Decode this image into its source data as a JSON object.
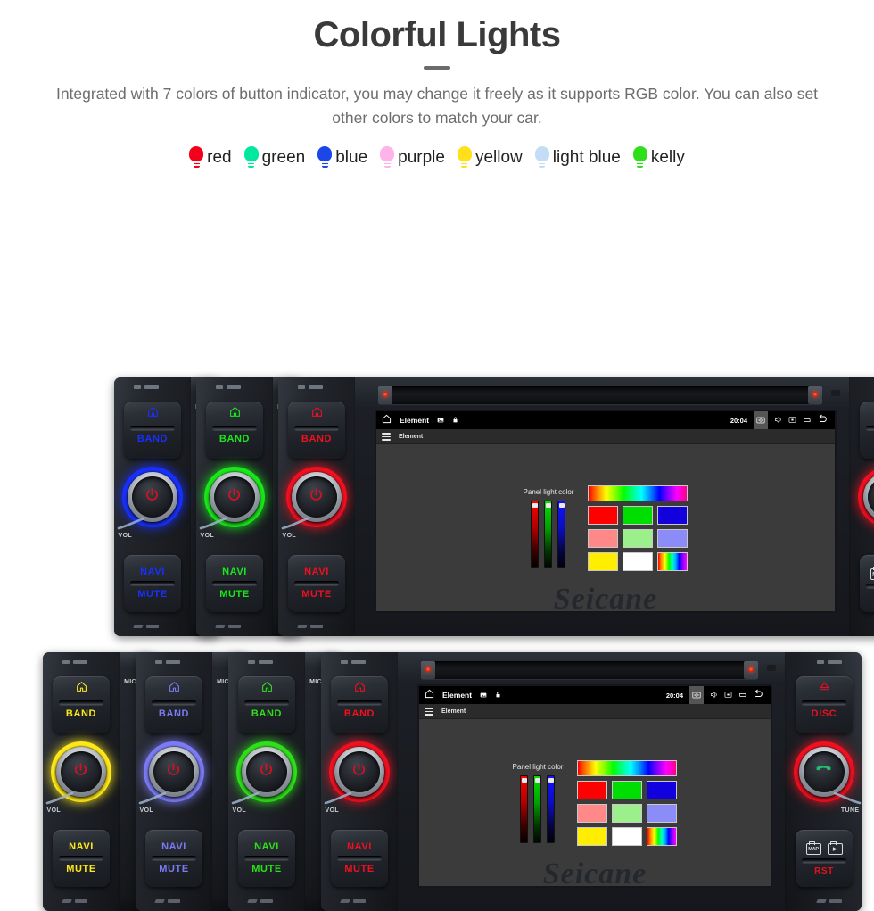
{
  "header": {
    "title": "Colorful Lights",
    "subtitle": "Integrated with 7 colors of button indicator, you may change it freely as it supports RGB color. You can also set other colors to match your car."
  },
  "legend": {
    "items": [
      {
        "label": "red",
        "color": "#f4001a"
      },
      {
        "label": "green",
        "color": "#00e8a0"
      },
      {
        "label": "blue",
        "color": "#1b47e8"
      },
      {
        "label": "purple",
        "color": "#ffb3e8"
      },
      {
        "label": "yellow",
        "color": "#ffe01a"
      },
      {
        "label": "light blue",
        "color": "#c3ddf7"
      },
      {
        "label": "kelly",
        "color": "#2ee01a"
      }
    ]
  },
  "unit": {
    "left_panel": {
      "home_icon": "home-icon",
      "band_label": "BAND",
      "navi_label": "NAVI",
      "mute_label": "MUTE",
      "vol_label": "VOL",
      "power_icon": "power-icon",
      "power_icon_color": "#d81020"
    },
    "right_panel": {
      "eject_icon": "eject-icon",
      "disc_label": "DISC",
      "tune_label": "TUNE",
      "phone_icon": "phone-icon",
      "phone_icon_color": "#1fbf6b",
      "map_label": "MAP",
      "media_label": "",
      "rst_label": "RST",
      "accent_color": "#e81020"
    },
    "mic_label": "MIC",
    "screen": {
      "statusbar": {
        "home_icon": "home-icon",
        "title": "Element",
        "image_icon": "image-icon",
        "lock_icon": "lock-icon",
        "time": "20:04",
        "screenshot_icon": "screenshot-icon",
        "volume_icon": "speaker-icon",
        "capture_icon": "screen-capture-icon",
        "recents_icon": "recent-apps-icon",
        "back_icon": "back-arrow-icon"
      },
      "appbar": {
        "menu_icon": "hamburger-menu-icon",
        "title": "Element"
      },
      "picker": {
        "label": "Panel light color",
        "sliders": [
          {
            "name": "red-slider",
            "color": "#ff0000"
          },
          {
            "name": "green-slider",
            "color": "#00e000"
          },
          {
            "name": "blue-slider",
            "color": "#1212ff"
          }
        ],
        "rainbow_bar": "rainbow-gradient-bar",
        "swatch_rows": [
          [
            {
              "name": "swatch-red",
              "color": "#ff0000"
            },
            {
              "name": "swatch-green",
              "color": "#00dd00"
            },
            {
              "name": "swatch-blue",
              "color": "#1200dd"
            }
          ],
          [
            {
              "name": "swatch-salmon",
              "color": "#ff8888"
            },
            {
              "name": "swatch-lightgreen",
              "color": "#9cf08c"
            },
            {
              "name": "swatch-periwinkle",
              "color": "#8c8cf8"
            }
          ],
          [
            {
              "name": "swatch-yellow",
              "color": "#ffee00"
            },
            {
              "name": "swatch-white",
              "color": "#ffffff"
            },
            {
              "name": "swatch-rainbow",
              "color": "rainbow"
            }
          ]
        ]
      },
      "watermark": "Seicane"
    }
  },
  "rows": {
    "top": {
      "units": [
        {
          "name": "unit-blue",
          "accent": "#1830ff",
          "glow": "#1830ff"
        },
        {
          "name": "unit-green",
          "accent": "#1ae81a",
          "glow": "#1ae81a"
        },
        {
          "name": "unit-red",
          "accent": "#f01020",
          "glow": "#f01020"
        }
      ]
    },
    "bottom": {
      "units": [
        {
          "name": "unit-yellow",
          "accent": "#ffe81a",
          "glow": "#ffe81a"
        },
        {
          "name": "unit-lightblue",
          "accent": "#7b7bf5",
          "glow": "#7b7bf5"
        },
        {
          "name": "unit-green",
          "accent": "#2ee01a",
          "glow": "#2ee01a"
        },
        {
          "name": "unit-red",
          "accent": "#f01020",
          "glow": "#f01020"
        }
      ]
    }
  }
}
